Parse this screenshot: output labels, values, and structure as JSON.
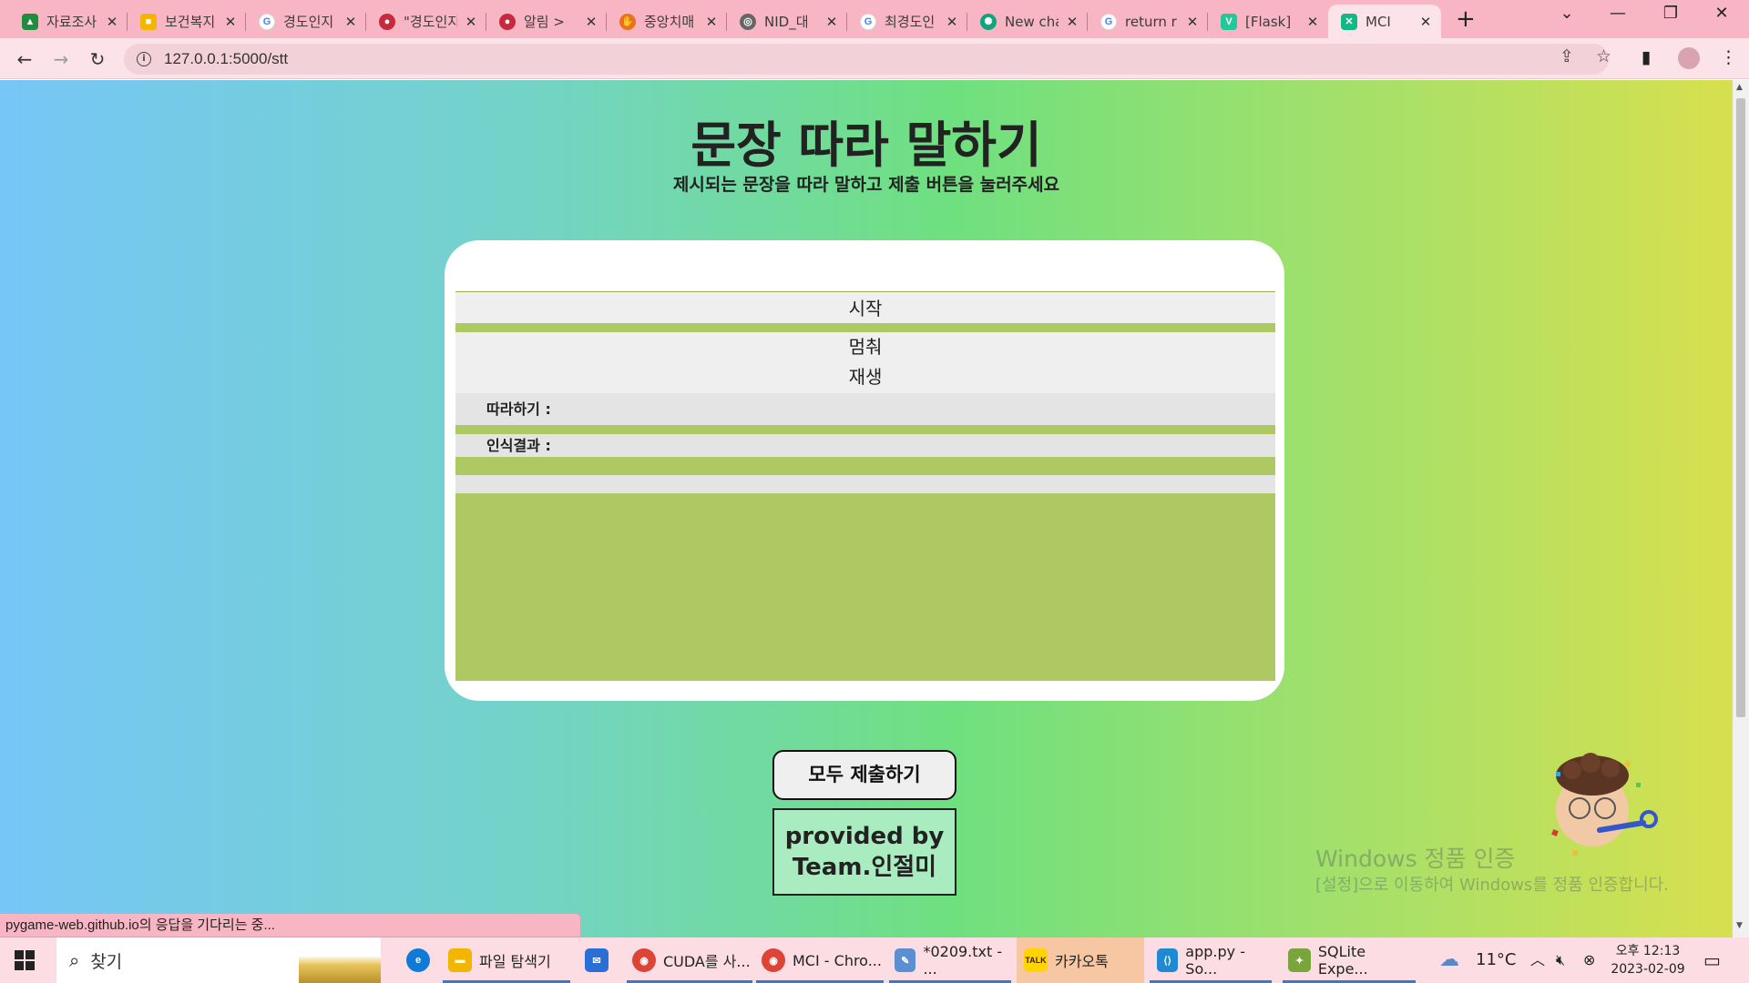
{
  "browser": {
    "tabs": [
      {
        "title": "자료조사",
        "icon": "google-drive-icon",
        "color": "#1e8e3e"
      },
      {
        "title": "보건복지",
        "icon": "slides-icon",
        "color": "#f4b400"
      },
      {
        "title": "경도인지",
        "icon": "google-icon",
        "color": "#4285f4"
      },
      {
        "title": "\"경도인지",
        "icon": "gov-emblem-icon",
        "color": "#c62a3c"
      },
      {
        "title": "알림 >",
        "icon": "gov-emblem-icon",
        "color": "#c62a3c"
      },
      {
        "title": "중앙치매",
        "icon": "hand-logo-icon",
        "color": "#e8731a"
      },
      {
        "title": "NID_대",
        "icon": "globe-icon",
        "color": "#666666"
      },
      {
        "title": "최경도인",
        "icon": "google-icon",
        "color": "#4285f4"
      },
      {
        "title": "New chat",
        "icon": "openai-icon",
        "color": "#10a37f"
      },
      {
        "title": "return r",
        "icon": "google-icon",
        "color": "#4285f4"
      },
      {
        "title": "[Flask]",
        "icon": "velog-icon",
        "color": "#20c997"
      },
      {
        "title": "MCI",
        "icon": "app-icon",
        "color": "#12b886"
      }
    ],
    "url": "127.0.0.1:5000/stt"
  },
  "page": {
    "title": "문장 따라 말하기",
    "subtitle": "제시되는 문장을 따라 말하고 제출 버튼을 눌러주세요",
    "buttons": {
      "start": "시작",
      "stop": "멈춰",
      "play": "재생"
    },
    "labels": {
      "follow": "따라하기 :",
      "result": "인식결과 :"
    },
    "submit_all": "모두 제출하기",
    "credit_line1": "provided by",
    "credit_line2": "Team.인절미",
    "windows_activation_title": "Windows 정품 인증",
    "windows_activation_sub": "[설정]으로 이동하여 Windows를 정품 인증합니다."
  },
  "status_bar": "pygame-web.github.io의 응답을 기다리는 중...",
  "taskbar": {
    "search_placeholder": "찾기",
    "apps": [
      {
        "label": "",
        "icon": "edge-icon",
        "color": "#0f7bd7"
      },
      {
        "label": "파일 탐색기",
        "icon": "folder-icon",
        "color": "#f3b600"
      },
      {
        "label": "",
        "icon": "mail-icon",
        "color": "#2a6fd6"
      },
      {
        "label": "CUDA를 사...",
        "icon": "chrome-icon",
        "color": "#db4437"
      },
      {
        "label": "MCI - Chro...",
        "icon": "chrome-icon",
        "color": "#db4437"
      },
      {
        "label": "*0209.txt - ...",
        "icon": "notepad-icon",
        "color": "#5b8fd1"
      },
      {
        "label": "카카오톡",
        "icon": "kakaotalk-icon",
        "color": "#3c1e1e"
      },
      {
        "label": "app.py - So...",
        "icon": "vscode-icon",
        "color": "#1f8ad2"
      },
      {
        "label": "SQLite Expe...",
        "icon": "sqlite-icon",
        "color": "#7aa53a"
      }
    ],
    "weather": "11°C",
    "time": "오후 12:13",
    "date": "2023-02-09"
  }
}
